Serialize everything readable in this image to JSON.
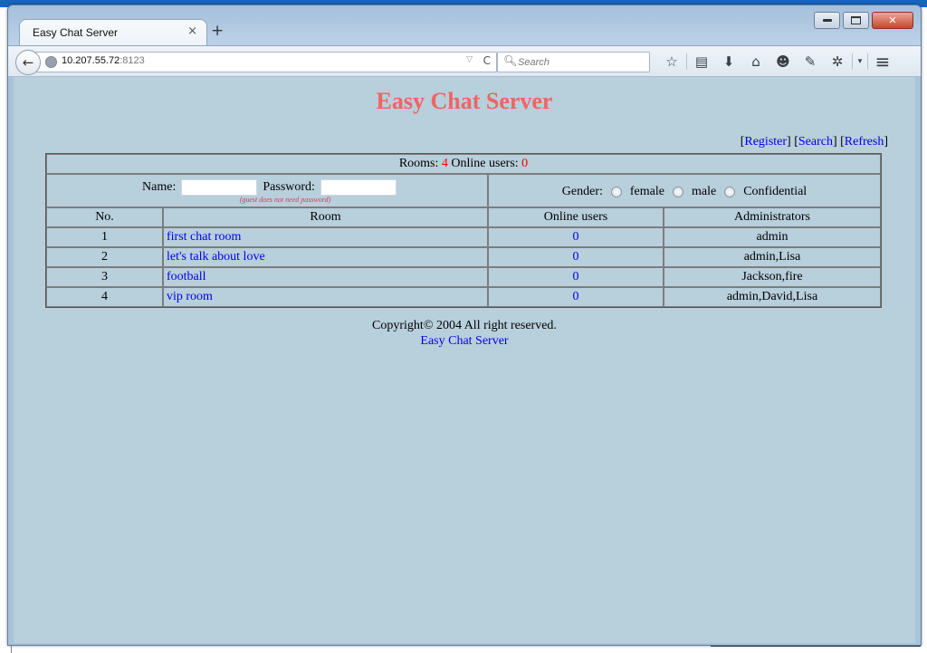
{
  "browser": {
    "tab_title": "Easy Chat Server",
    "tab_close_icon": "×",
    "new_tab_icon": "+",
    "url_host": "10.207.55.72",
    "url_port": ":8123",
    "search_placeholder": "Search",
    "icons": {
      "back": "🡐",
      "dropdown": "▽",
      "reload": "C",
      "search": "⚲",
      "bookmark_star": "☆",
      "reading_list": "▤",
      "download": "⬇",
      "home": "⌂",
      "chat": "☻",
      "notes": "✎",
      "extension": "✲",
      "overflow": "▾",
      "menu": "≡"
    },
    "window_controls": {
      "close": "✕"
    }
  },
  "page": {
    "title": "Easy Chat Server",
    "top_links": {
      "register": "Register",
      "search": "Search",
      "refresh": "Refresh"
    },
    "summary": {
      "rooms_label": "Rooms:",
      "rooms_count": "4",
      "online_label": "Online users:",
      "online_count": "0"
    },
    "login": {
      "name_label": "Name:",
      "name_value": "",
      "password_label": "Password:",
      "password_value": "",
      "hint": "(guest does not need password)"
    },
    "gender": {
      "label": "Gender:",
      "options": [
        "female",
        "male",
        "Confidential"
      ]
    },
    "table": {
      "headers": [
        "No.",
        "Room",
        "Online users",
        "Administrators"
      ],
      "rows": [
        {
          "no": "1",
          "room": "first chat room",
          "online": "0",
          "admins": "admin"
        },
        {
          "no": "2",
          "room": "let's talk about love",
          "online": "0",
          "admins": "admin,Lisa"
        },
        {
          "no": "3",
          "room": "football",
          "online": "0",
          "admins": "Jackson,fire"
        },
        {
          "no": "4",
          "room": "vip room",
          "online": "0",
          "admins": "admin,David,Lisa"
        }
      ]
    },
    "footer": {
      "copyright": "Copyright© 2004 All right reserved.",
      "link": "Easy Chat Server"
    }
  },
  "colors": {
    "title": "#f06464",
    "link": "#0000ee",
    "count_highlight": "#ff0000",
    "page_background": "#b8cfdc"
  }
}
